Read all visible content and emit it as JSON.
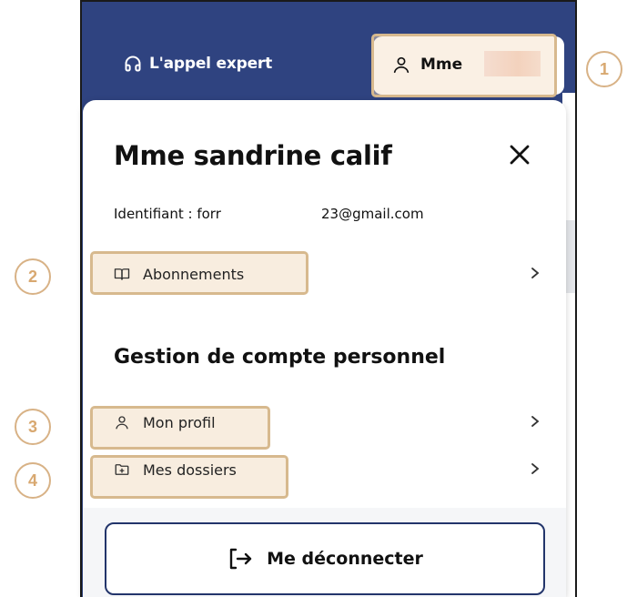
{
  "header": {
    "appel_label": "L'appel expert",
    "user_button_label": "Mme"
  },
  "panel": {
    "title": "Mme sandrine calif",
    "identifier_prefix": "Identifiant : forr",
    "identifier_suffix": "23@gmail.com",
    "items": [
      {
        "label": "Abonnements",
        "icon": "book-icon"
      },
      {
        "label": "Mon profil",
        "icon": "user-icon"
      },
      {
        "label": "Mes dossiers",
        "icon": "folder-plus-icon"
      }
    ],
    "section_title": "Gestion de compte personnel",
    "logout_label": "Me déconnecter"
  },
  "callouts": [
    "1",
    "2",
    "3",
    "4"
  ],
  "colors": {
    "header_bg": "#2f4380",
    "highlight": "#d7b98e",
    "callout": "#d8a870",
    "logout_border": "#23356b"
  }
}
